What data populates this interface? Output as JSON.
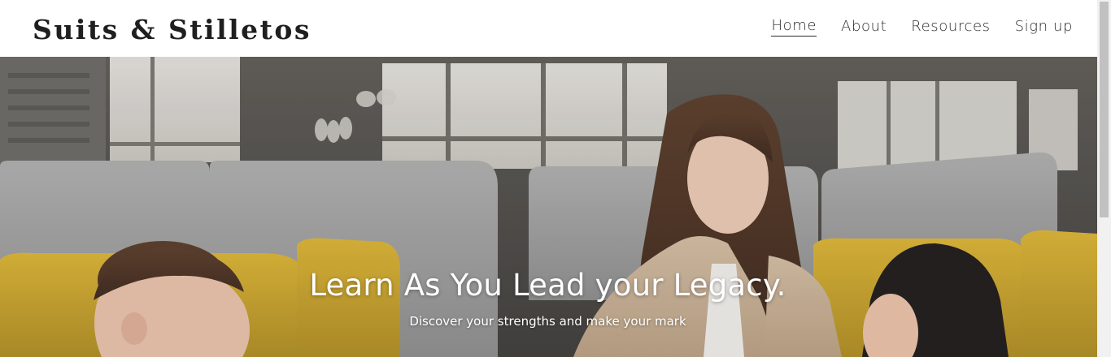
{
  "header": {
    "logo": "Suits & Stilletos",
    "nav": [
      {
        "label": "Home",
        "active": true
      },
      {
        "label": "About",
        "active": false
      },
      {
        "label": "Resources",
        "active": false
      },
      {
        "label": "Sign up",
        "active": false
      }
    ]
  },
  "hero": {
    "title": "Learn As You Lead your Legacy.",
    "subtitle": "Discover your strengths and make your mark",
    "image_description_colors": {
      "chair_yellow": "#d9b02e",
      "booth_gray": "#a8a8a8",
      "wall_dark": "#4a4844"
    }
  },
  "colors": {
    "header_bg": "#ffffff",
    "text_dark": "#1f1f1f",
    "hero_text": "#ffffff"
  }
}
